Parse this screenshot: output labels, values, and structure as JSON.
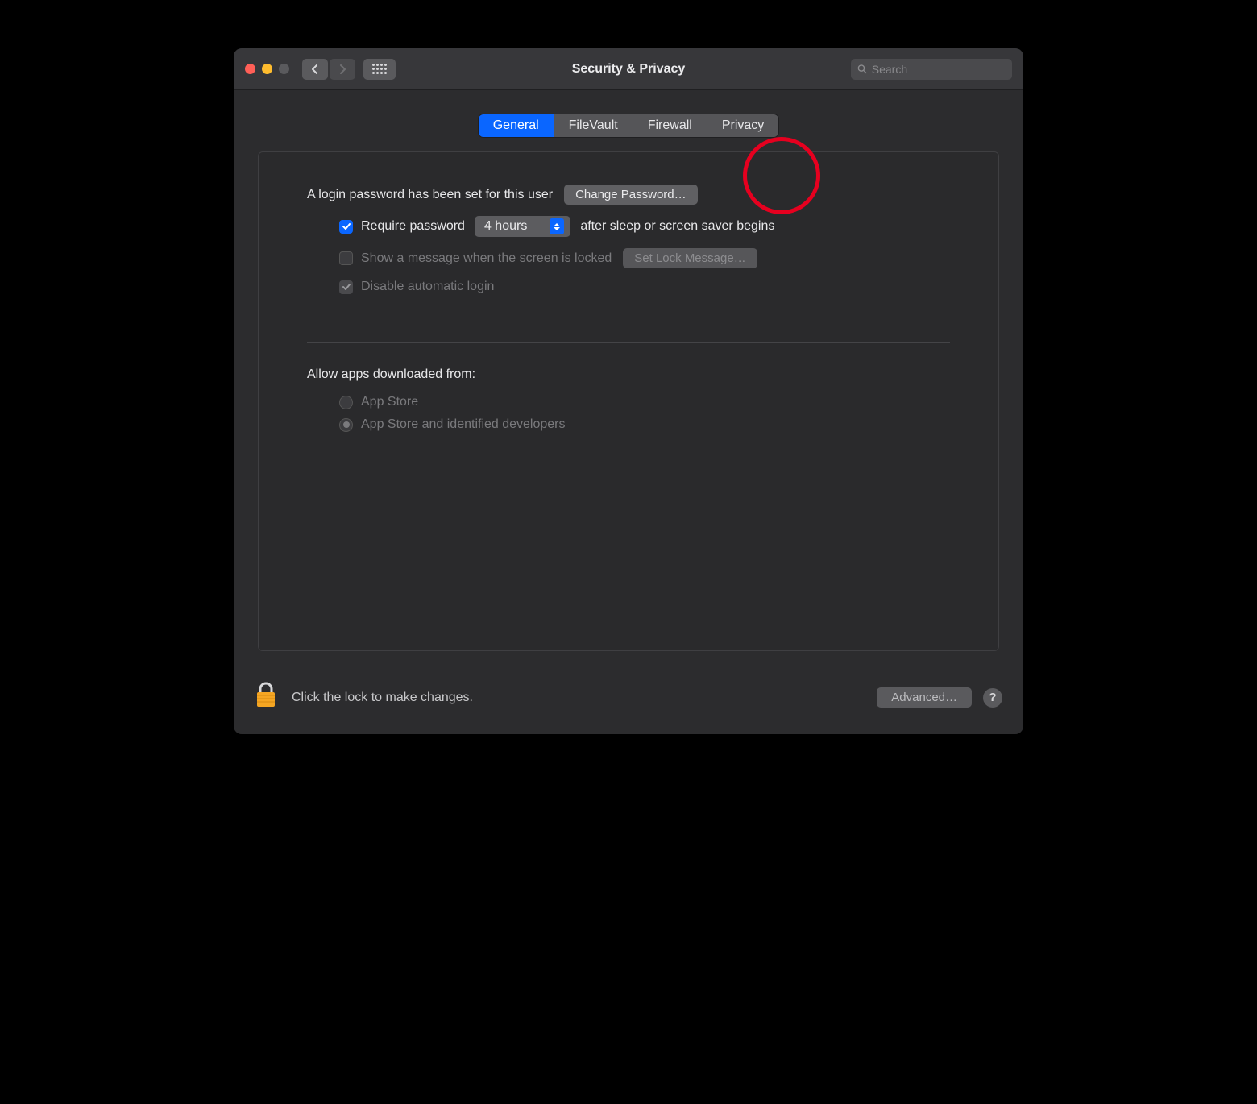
{
  "window": {
    "title": "Security & Privacy",
    "search_placeholder": "Search"
  },
  "tabs": {
    "general": "General",
    "filevault": "FileVault",
    "firewall": "Firewall",
    "privacy": "Privacy"
  },
  "general": {
    "login_password_set": "A login password has been set for this user",
    "change_password": "Change Password…",
    "require_password_label": "Require password",
    "require_password_delay": "4 hours",
    "require_password_suffix": "after sleep or screen saver begins",
    "show_message_label": "Show a message when the screen is locked",
    "set_lock_message": "Set Lock Message…",
    "disable_auto_login": "Disable automatic login",
    "allow_apps_title": "Allow apps downloaded from:",
    "allow_app_store": "App Store",
    "allow_app_store_identified": "App Store and identified developers"
  },
  "footer": {
    "lock_text": "Click the lock to make changes.",
    "advanced": "Advanced…",
    "help": "?"
  }
}
